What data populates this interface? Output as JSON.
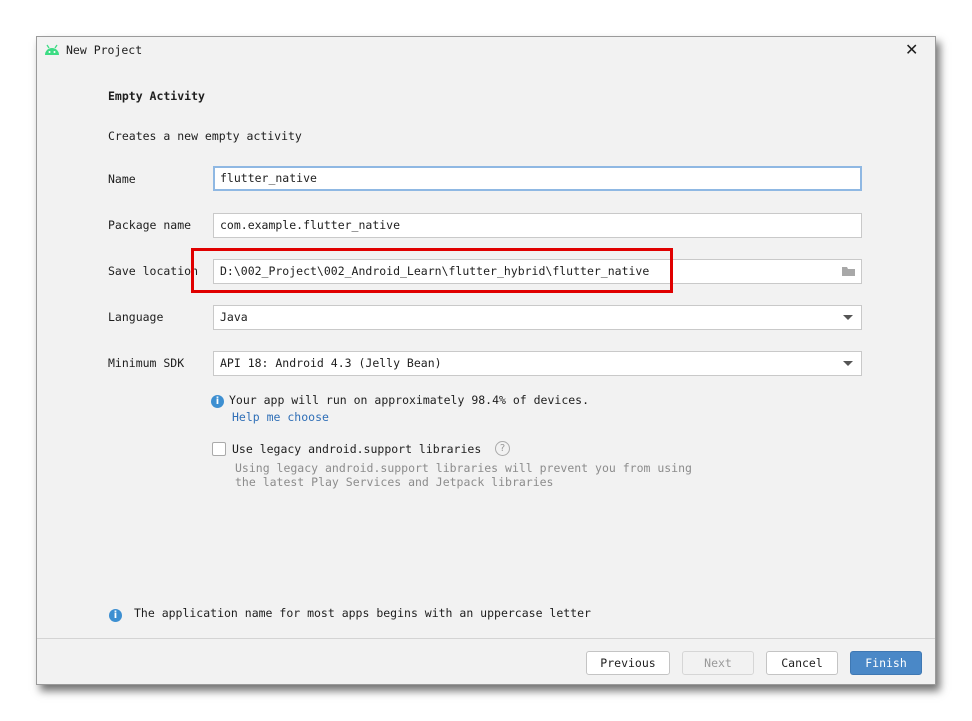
{
  "window": {
    "title": "New Project",
    "close_icon": "close-icon"
  },
  "header": {
    "title": "Empty Activity",
    "description": "Creates a new empty activity"
  },
  "form": {
    "name": {
      "label": "Name",
      "value": "flutter_native"
    },
    "package": {
      "label": "Package name",
      "value": "com.example.flutter_native"
    },
    "save_location": {
      "label": "Save location",
      "value": "D:\\002_Project\\002_Android_Learn\\flutter_hybrid\\flutter_native"
    },
    "language": {
      "label": "Language",
      "value": "Java"
    },
    "min_sdk": {
      "label": "Minimum SDK",
      "value": "API 18: Android 4.3 (Jelly Bean)"
    }
  },
  "sdk_info": {
    "text": "Your app will run on approximately 98.4% of devices.",
    "link": "Help me choose"
  },
  "legacy": {
    "label": "Use legacy android.support libraries",
    "checked": false,
    "help": "Using legacy android.support libraries will prevent you from using",
    "help2": "the latest Play Services and Jetpack libraries"
  },
  "footer_info": "The application name for most apps begins with an uppercase letter",
  "buttons": {
    "previous": "Previous",
    "next": "Next",
    "cancel": "Cancel",
    "finish": "Finish"
  },
  "colors": {
    "accent": "#4a88c7",
    "highlight": "#e00000",
    "link": "#2f6fb7"
  }
}
